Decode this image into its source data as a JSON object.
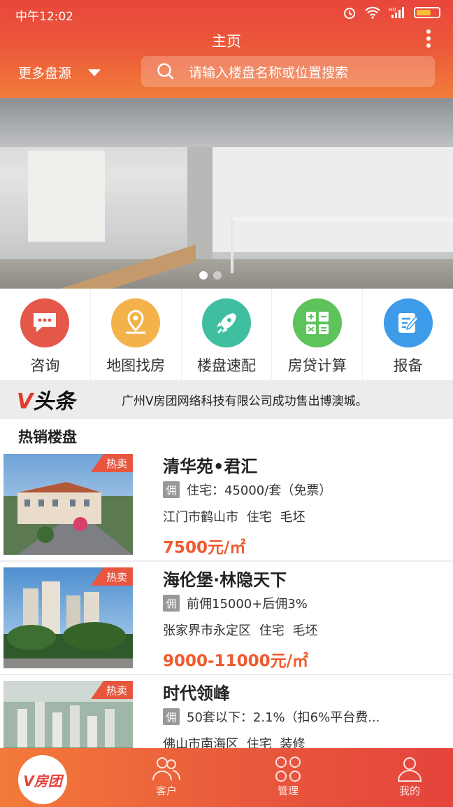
{
  "status_bar": {
    "time": "中午12:02",
    "network": "HD"
  },
  "header": {
    "title": "主页",
    "city": "更多盘源",
    "search_placeholder": "请输入楼盘名称或位置搜索"
  },
  "banner": {
    "page_count": 2,
    "active_page": 1
  },
  "quick_menu": [
    {
      "label": "咨询",
      "icon": "chat-bubble-icon",
      "color": "#e4584a"
    },
    {
      "label": "地图找房",
      "icon": "map-pin-icon",
      "color": "#f3b34a"
    },
    {
      "label": "楼盘速配",
      "icon": "rocket-icon",
      "color": "#3fbfa0"
    },
    {
      "label": "房贷计算",
      "icon": "calculator-icon",
      "color": "#5dc35a"
    },
    {
      "label": "报备",
      "icon": "edit-document-icon",
      "color": "#3d9be9"
    }
  ],
  "news": {
    "logo_v": "V",
    "logo_text": "头条",
    "text": "广州V房团网络科技有限公司成功售出博澳城。"
  },
  "hot_section": {
    "title": "热销楼盘"
  },
  "listings": [
    {
      "tag": "热卖",
      "name": "清华苑•君汇",
      "badge": "佣",
      "commission": "住宅：45000/套（免票）",
      "location": "江门市鹤山市  住宅  毛坯",
      "price": "7500元/㎡"
    },
    {
      "tag": "热卖",
      "name": "海伦堡·林隐天下",
      "badge": "佣",
      "commission": "前佣15000+后佣3%",
      "location": "张家界市永定区  住宅  毛坯",
      "price": "9000-11000元/㎡"
    },
    {
      "tag": "热卖",
      "name": "时代领峰",
      "badge": "佣",
      "commission": "50套以下：2.1%（扣6%平台费...",
      "location": "佛山市南海区  住宅  装修",
      "price": ""
    }
  ],
  "tab_bar": {
    "home_logo": "V房团",
    "tabs": [
      {
        "label": "客户",
        "icon": "people-icon"
      },
      {
        "label": "管理",
        "icon": "grid-icon"
      },
      {
        "label": "我的",
        "icon": "person-icon"
      }
    ]
  },
  "colors": {
    "primary": "#e8463c",
    "accent": "#f17d3b",
    "price": "#ef5a2e"
  }
}
